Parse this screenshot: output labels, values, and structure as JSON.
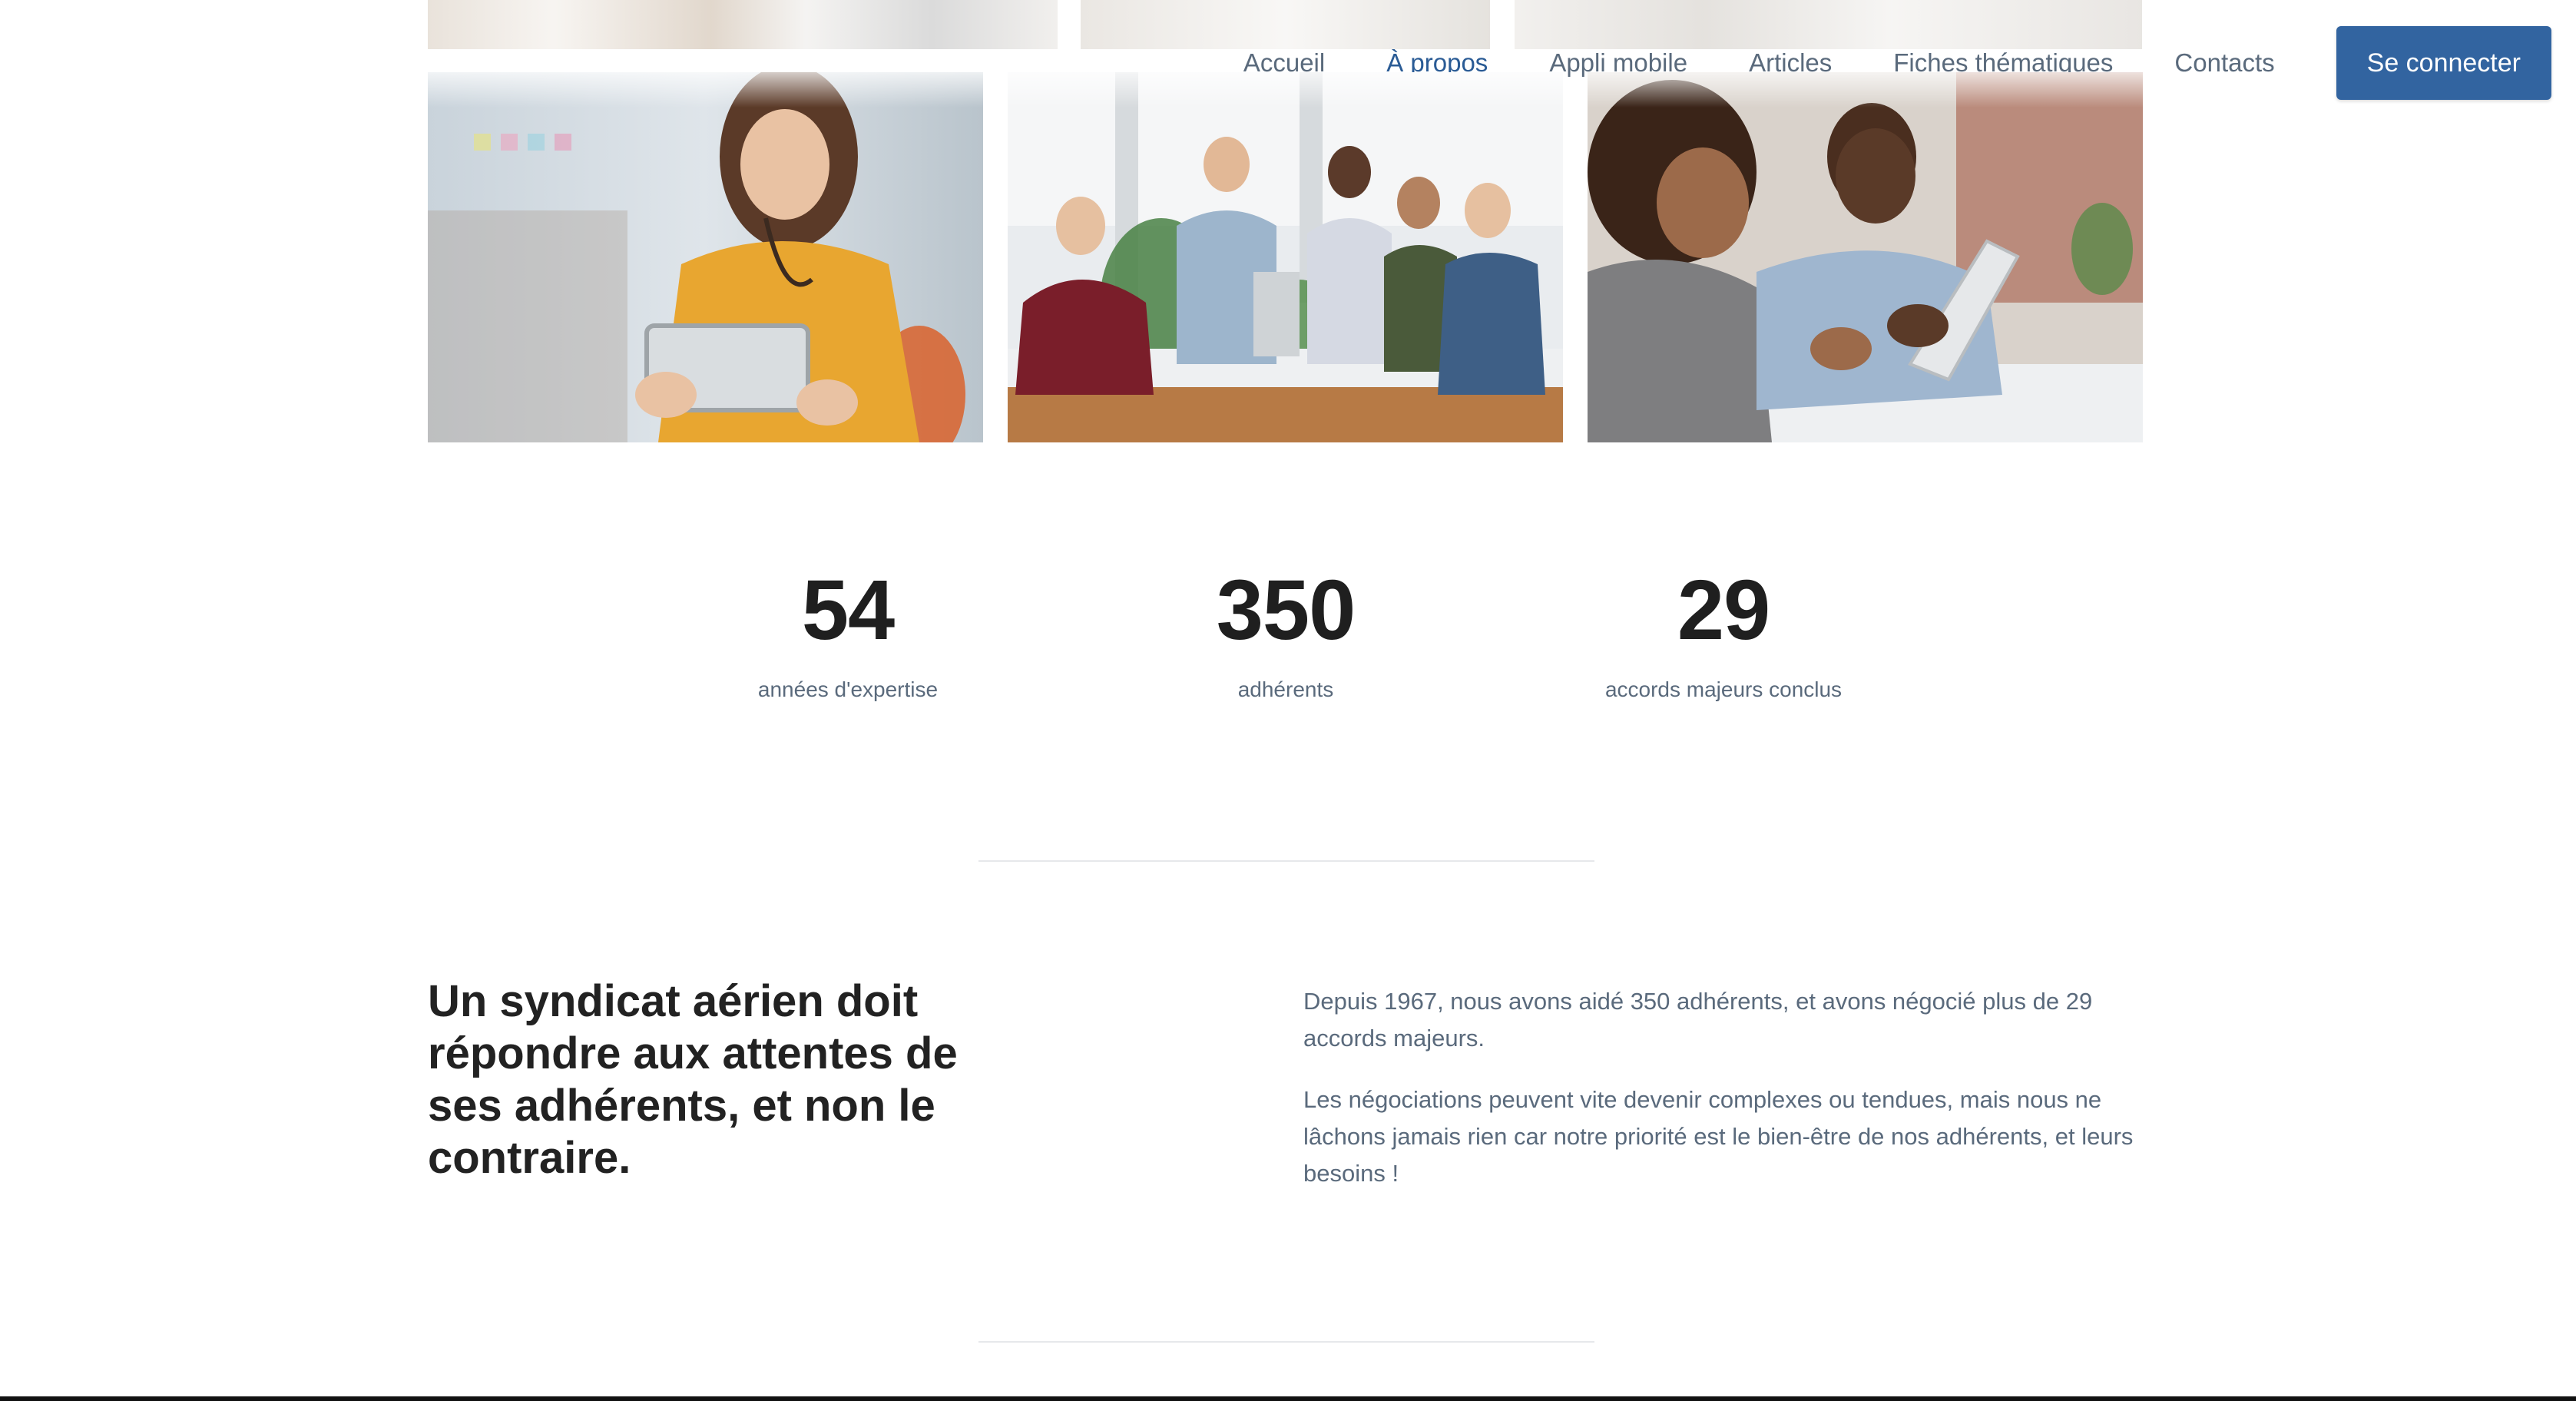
{
  "nav": {
    "items": [
      {
        "label": "Accueil",
        "active": false
      },
      {
        "label": "À propos",
        "active": true
      },
      {
        "label": "Appli mobile",
        "active": false
      },
      {
        "label": "Articles",
        "active": false
      },
      {
        "label": "Fiches thématiques",
        "active": false
      },
      {
        "label": "Contacts",
        "active": false
      }
    ],
    "login_label": "Se connecter"
  },
  "stats": [
    {
      "value": "54",
      "label": "années d'expertise"
    },
    {
      "value": "350",
      "label": "adhérents"
    },
    {
      "value": "29",
      "label": "accords majeurs conclus"
    }
  ],
  "about": {
    "headline": "Un syndicat aérien doit répondre aux attentes de ses adhérents, et non le contraire.",
    "paragraphs": [
      "Depuis 1967, nous avons aidé 350 adhérents, et avons négocié plus de 29 accords majeurs.",
      "Les négociations peuvent vite devenir complexes ou tendues, mais nous ne lâchons jamais rien car notre priorité est le bien-être de nos adhérents, et leurs besoins !"
    ]
  },
  "colors": {
    "brand_blue": "#3264a0",
    "active_nav": "#2a5b95",
    "muted_text": "#5a6a7c",
    "heading": "#222222"
  }
}
